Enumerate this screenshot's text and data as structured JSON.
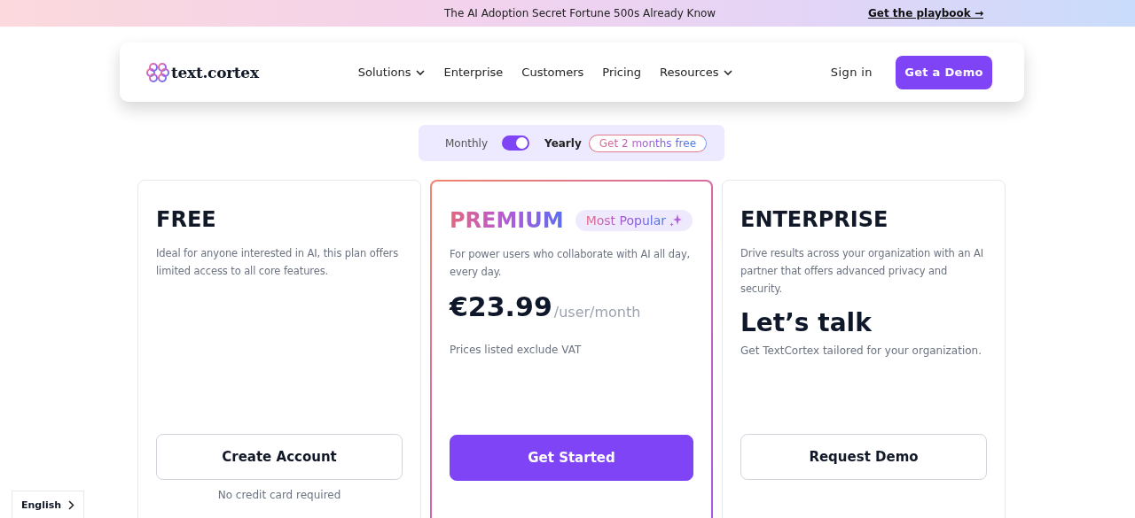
{
  "banner": {
    "text": "The AI Adoption Secret Fortune 500s Already Know",
    "link": "Get the playbook →"
  },
  "nav": {
    "logo": "text.cortex",
    "items": [
      {
        "label": "Solutions",
        "dropdown": true
      },
      {
        "label": "Enterprise",
        "dropdown": false
      },
      {
        "label": "Customers",
        "dropdown": false
      },
      {
        "label": "Pricing",
        "dropdown": false
      },
      {
        "label": "Resources",
        "dropdown": true
      }
    ],
    "sign_in": "Sign in",
    "cta": "Get a Demo"
  },
  "billing": {
    "monthly": "Monthly",
    "yearly": "Yearly",
    "on": true,
    "offer": "Get 2 months free"
  },
  "plans": [
    {
      "name": "FREE",
      "featured": false,
      "description": "Ideal for anyone interested in AI, this plan offers limited access to all core features.",
      "button": "Create Account",
      "footnote": "No credit card required"
    },
    {
      "name": "PREMIUM",
      "featured": true,
      "badge": "Most Popular",
      "description": "For power users who collaborate with AI all day, every day.",
      "price": "€23.99",
      "period": "/user/month",
      "note": "Prices listed exclude VAT",
      "button": "Get Started"
    },
    {
      "name": "ENTERPRISE",
      "featured": false,
      "description": "Drive results across your organization with an AI partner that offers advanced privacy and security.",
      "price_text": "Let’s talk",
      "note": "Get TextCortex tailored for your organization.",
      "button": "Request Demo"
    }
  ],
  "language": {
    "label": "English"
  }
}
